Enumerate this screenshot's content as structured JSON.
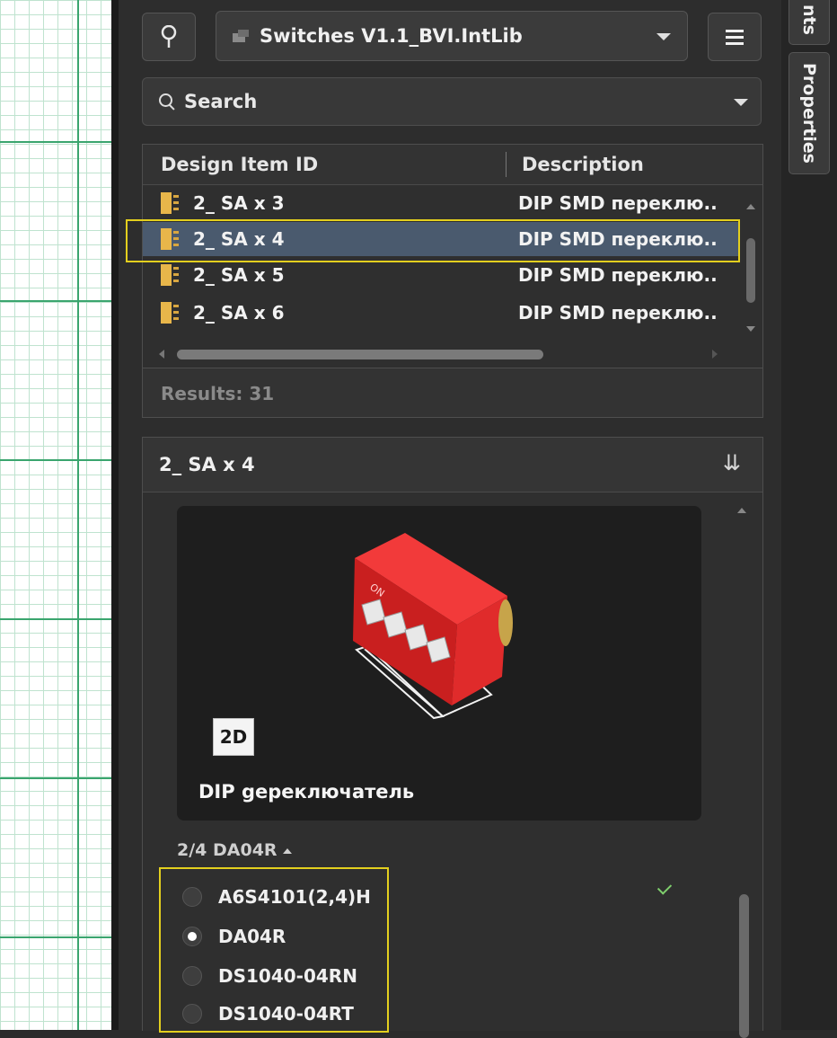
{
  "toolbar": {
    "library_name": "Switches V1.1_BVI.IntLib",
    "filter_icon": "filter-icon",
    "menu_icon": "hamburger-menu-icon"
  },
  "search": {
    "placeholder": "Search"
  },
  "table": {
    "columns": [
      "Design Item ID",
      "Description"
    ],
    "rows": [
      {
        "id": "2_ SA x 3",
        "description": "DIP  SMD  переклю.."
      },
      {
        "id": "2_ SA x 4",
        "description": "DIP  SMD  переклю..",
        "selected": true
      },
      {
        "id": "2_ SA x 5",
        "description": "DIP  SMD  переклю.."
      },
      {
        "id": "2_ SA x 6",
        "description": "DIP  SMD  переклю.."
      }
    ]
  },
  "results": "Results: 31",
  "detail": {
    "title": "2_ SA x 4",
    "view_button": "2D",
    "caption": "DIP gереключатель",
    "variant_label": "2/4  DA04R",
    "variants": [
      {
        "name": "A6S4101(2,4)H",
        "selected": false
      },
      {
        "name": "DA04R",
        "selected": true
      },
      {
        "name": "DS1040-04RN",
        "selected": false
      },
      {
        "name": "DS1040-04RT",
        "selected": false
      }
    ]
  },
  "side_tabs": {
    "top": "nts",
    "properties": "Properties"
  },
  "colors": {
    "highlight": "#e3cf1e",
    "selected_row": "#4a5a6e",
    "component_red": "#e02b2b"
  }
}
